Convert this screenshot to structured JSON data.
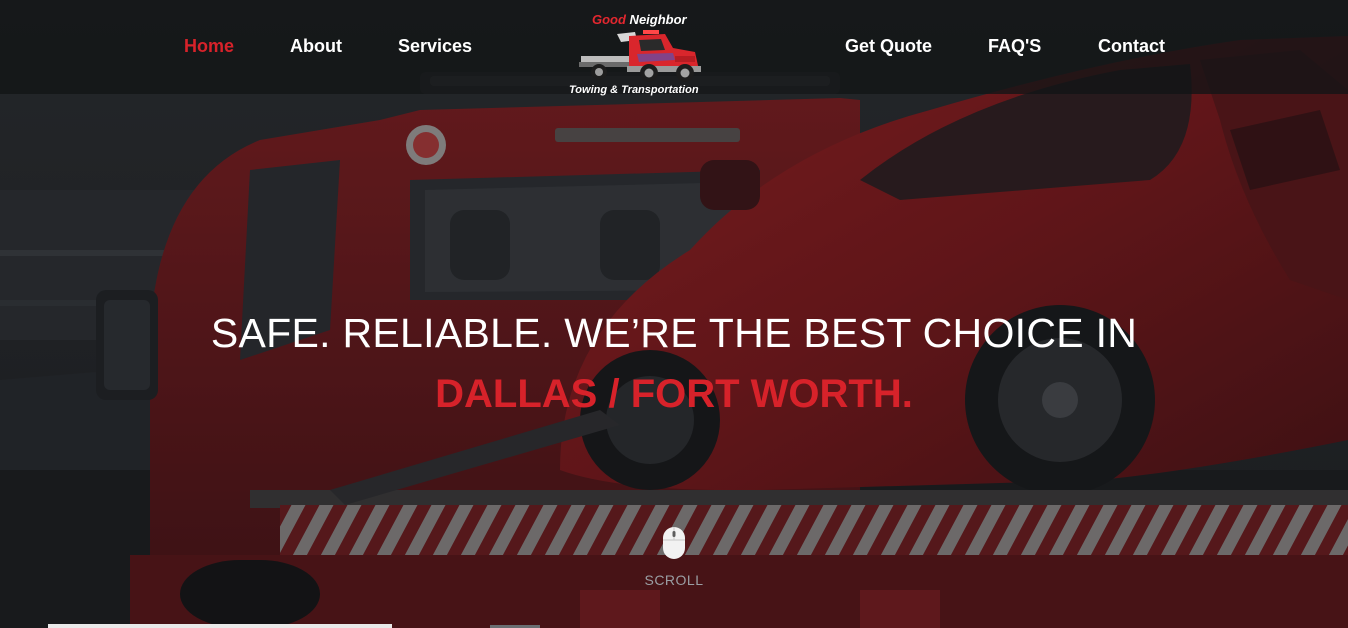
{
  "nav": {
    "items": [
      {
        "label": "Home",
        "active": true
      },
      {
        "label": "About"
      },
      {
        "label": "Services"
      },
      {
        "label": "Get Quote"
      },
      {
        "label": "FAQ'S"
      },
      {
        "label": "Contact"
      }
    ]
  },
  "logo": {
    "word1": "Good",
    "word2": " Neighbor",
    "tagline": "Towing & Transportation",
    "icon": "tow-truck-icon"
  },
  "hero": {
    "headline": "SAFE. RELIABLE. WE’RE THE BEST CHOICE IN",
    "accent": "DALLAS / FORT WORTH.",
    "scroll_label": "SCROLL",
    "scroll_icon": "mouse-icon"
  },
  "colors": {
    "accent": "#d7222a",
    "nav_bg": "#121416",
    "text": "#ffffff"
  }
}
